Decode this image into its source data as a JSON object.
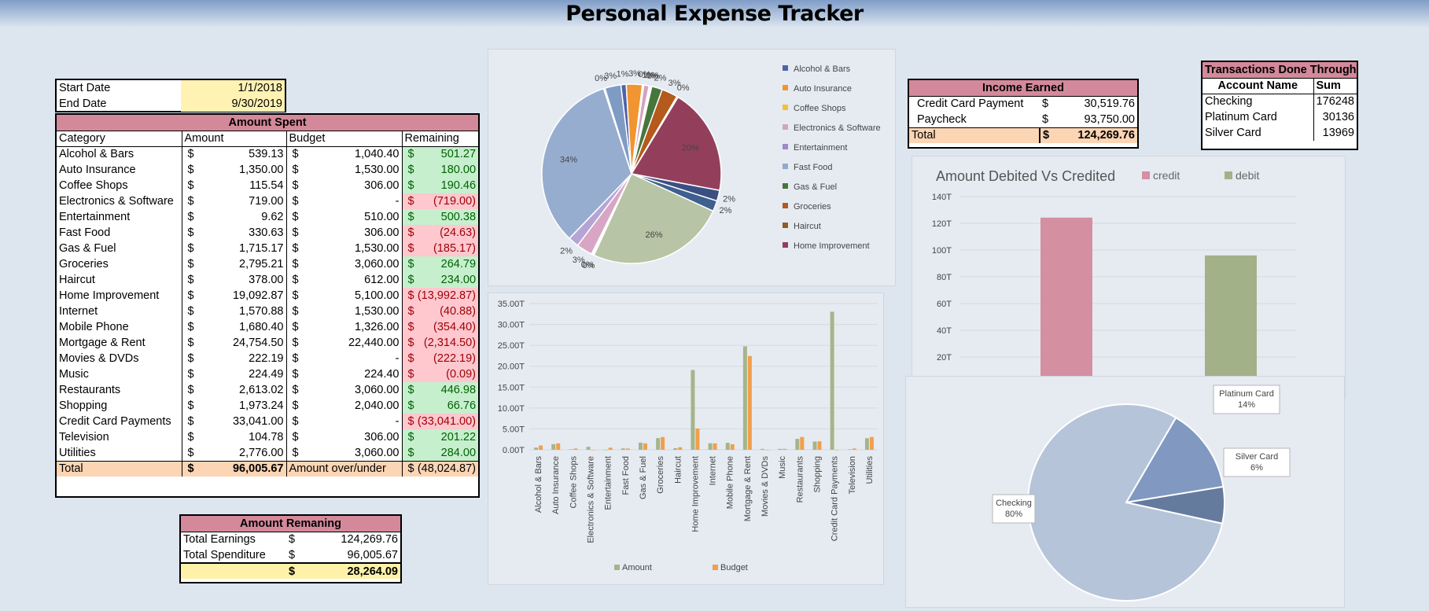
{
  "title": "Personal Expense Tracker",
  "dates": {
    "start_label": "Start Date",
    "start_value": "1/1/2018",
    "end_label": "End Date",
    "end_value": "9/30/2019"
  },
  "spent": {
    "title": "Amount Spent",
    "headers": [
      "Category",
      "Amount",
      "Budget",
      "Remaining"
    ],
    "rows": [
      [
        "Alcohol & Bars",
        "539.13",
        "1,040.40",
        "501.27",
        "pos"
      ],
      [
        "Auto Insurance",
        "1,350.00",
        "1,530.00",
        "180.00",
        "pos"
      ],
      [
        "Coffee Shops",
        "115.54",
        "306.00",
        "190.46",
        "pos"
      ],
      [
        "Electronics & Software",
        "719.00",
        "-",
        "(719.00)",
        "neg"
      ],
      [
        "Entertainment",
        "9.62",
        "510.00",
        "500.38",
        "pos"
      ],
      [
        "Fast Food",
        "330.63",
        "306.00",
        "(24.63)",
        "neg"
      ],
      [
        "Gas & Fuel",
        "1,715.17",
        "1,530.00",
        "(185.17)",
        "neg"
      ],
      [
        "Groceries",
        "2,795.21",
        "3,060.00",
        "264.79",
        "pos"
      ],
      [
        "Haircut",
        "378.00",
        "612.00",
        "234.00",
        "pos"
      ],
      [
        "Home Improvement",
        "19,092.87",
        "5,100.00",
        "(13,992.87)",
        "neg"
      ],
      [
        "Internet",
        "1,570.88",
        "1,530.00",
        "(40.88)",
        "neg"
      ],
      [
        "Mobile Phone",
        "1,680.40",
        "1,326.00",
        "(354.40)",
        "neg"
      ],
      [
        "Mortgage & Rent",
        "24,754.50",
        "22,440.00",
        "(2,314.50)",
        "neg"
      ],
      [
        "Movies & DVDs",
        "222.19",
        "-",
        "(222.19)",
        "neg"
      ],
      [
        "Music",
        "224.49",
        "224.40",
        "(0.09)",
        "neg"
      ],
      [
        "Restaurants",
        "2,613.02",
        "3,060.00",
        "446.98",
        "pos"
      ],
      [
        "Shopping",
        "1,973.24",
        "2,040.00",
        "66.76",
        "pos"
      ],
      [
        "Credit Card Payments",
        "33,041.00",
        "-",
        "(33,041.00)",
        "neg"
      ],
      [
        "Television",
        "104.78",
        "306.00",
        "201.22",
        "pos"
      ],
      [
        "Utilities",
        "2,776.00",
        "3,060.00",
        "284.00",
        "pos"
      ]
    ],
    "total_label": "Total",
    "total_amount": "96,005.67",
    "overunder_label": "Amount over/under",
    "overunder_value": "(48,024.87)",
    "currency": "$"
  },
  "remaining": {
    "title": "Amount Remaning",
    "earnings_label": "Total Earnings",
    "earnings_value": "124,269.76",
    "spend_label": "Total Spenditure",
    "spend_value": "96,005.67",
    "net_value": "28,264.09"
  },
  "income": {
    "title": "Income Earned",
    "rows": [
      [
        "Credit Card Payment",
        "30,519.76"
      ],
      [
        "Paycheck",
        "93,750.00"
      ]
    ],
    "total_label": "Total",
    "total_value": "124,269.76"
  },
  "transactions": {
    "title": "Transactions Done Through",
    "headers": [
      "Account Name",
      "Sum"
    ],
    "rows": [
      [
        "Checking",
        "176248"
      ],
      [
        "Platinum Card",
        "30136"
      ],
      [
        "Silver Card",
        "13969"
      ]
    ]
  },
  "chart_data": [
    {
      "type": "pie",
      "title": "",
      "legend_position": "right",
      "legend": [
        "Alcohol & Bars",
        "Auto Insurance",
        "Coffee Shops",
        "Electronics & Software",
        "Entertainment",
        "Fast Food",
        "Gas & Fuel",
        "Groceries",
        "Haircut",
        "Home Improvement"
      ],
      "slices": [
        {
          "label": "Alcohol & Bars",
          "value": 1,
          "text": "1%",
          "color": "#4e63a8"
        },
        {
          "label": "Auto Insurance",
          "value": 3,
          "text": "3%",
          "color": "#f0952f"
        },
        {
          "label": "Coffee Shops",
          "value": 0,
          "text": "0%",
          "color": "#f1c232"
        },
        {
          "label": "Electronics & Software",
          "value": 1,
          "text": "1%",
          "color": "#d4a3bf"
        },
        {
          "label": "Entertainment",
          "value": 0,
          "text": "0%",
          "color": "#9d8bc4"
        },
        {
          "label": "Fast Food",
          "value": 0,
          "text": "0%",
          "color": "#93a9cc"
        },
        {
          "label": "Gas & Fuel",
          "value": 2,
          "text": "2%",
          "color": "#47763c"
        },
        {
          "label": "Groceries",
          "value": 3,
          "text": "3%",
          "color": "#b35a1c"
        },
        {
          "label": "Haircut",
          "value": 0,
          "text": "0%",
          "color": "#8d5e24"
        },
        {
          "label": "Home Improvement",
          "value": 20,
          "text": "20%",
          "color": "#933f5c"
        },
        {
          "label": "Internet",
          "value": 2,
          "text": "2%",
          "color": "#3b4f82"
        },
        {
          "label": "Mobile Phone",
          "value": 2,
          "text": "2%",
          "color": "#3f5f8f"
        },
        {
          "label": "Mortgage & Rent",
          "value": 26,
          "text": "26%",
          "color": "#b7c4a5"
        },
        {
          "label": "Movies & DVDs",
          "value": 0,
          "text": "0%",
          "color": "#a8c0dc"
        },
        {
          "label": "Music",
          "value": 0,
          "text": "0%",
          "color": "#c7d5e5"
        },
        {
          "label": "Restaurants",
          "value": 3,
          "text": "3%",
          "color": "#d8a5c4"
        },
        {
          "label": "Shopping",
          "value": 2,
          "text": "2%",
          "color": "#b4a5d6"
        },
        {
          "label": "Credit Card Payments",
          "value": 34,
          "text": "34%",
          "color": "#96add0"
        },
        {
          "label": "Television",
          "value": 0,
          "text": "0%",
          "color": "#aec3de"
        },
        {
          "label": "Utilities",
          "value": 3,
          "text": "3%",
          "color": "#7f9bc4"
        }
      ]
    },
    {
      "type": "bar",
      "title": "",
      "categories": [
        "Alcohol & Bars",
        "Auto Insurance",
        "Coffee Shops",
        "Electronics & Software",
        "Entertainment",
        "Fast Food",
        "Gas & Fuel",
        "Groceries",
        "Haircut",
        "Home Improvement",
        "Internet",
        "Mobile Phone",
        "Mortgage & Rent",
        "Movies & DVDs",
        "Music",
        "Restaurants",
        "Shopping",
        "Credit Card Payments",
        "Television",
        "Utilities"
      ],
      "series": [
        {
          "name": "Amount",
          "color": "#a5b58a",
          "values": [
            539.13,
            1350,
            115.54,
            719,
            9.62,
            330.63,
            1715.17,
            2795.21,
            378,
            19092.87,
            1570.88,
            1680.4,
            24754.5,
            222.19,
            224.49,
            2613.02,
            1973.24,
            33041,
            104.78,
            2776
          ]
        },
        {
          "name": "Budget",
          "color": "#f0a04b",
          "values": [
            1040.4,
            1530,
            306,
            0,
            510,
            306,
            1530,
            3060,
            612,
            5100,
            1530,
            1326,
            22440,
            0,
            224.4,
            3060,
            2040,
            0,
            306,
            3060
          ]
        }
      ],
      "yticks": [
        "0.00T",
        "5.00T",
        "10.00T",
        "15.00T",
        "20.00T",
        "25.00T",
        "30.00T",
        "35.00T"
      ],
      "ylim": [
        0,
        35000
      ],
      "legend_position": "bottom"
    },
    {
      "type": "bar",
      "title": "Amount Debited Vs Credited",
      "categories": [
        "credit",
        "debit"
      ],
      "series": [
        {
          "name": "credit",
          "color": "#d48fa0",
          "values": [
            124269.76
          ]
        },
        {
          "name": "debit",
          "color": "#a3b189",
          "values": [
            96005.67
          ]
        }
      ],
      "yticks": [
        "0T",
        "20T",
        "40T",
        "60T",
        "80T",
        "100T",
        "120T",
        "140T"
      ],
      "ylim": [
        0,
        140000
      ],
      "legend_position": "top"
    },
    {
      "type": "pie",
      "title": "",
      "slices": [
        {
          "label": "Checking",
          "value": 80,
          "text": "80%",
          "color": "#b6c4da"
        },
        {
          "label": "Platinum Card",
          "value": 14,
          "text": "14%",
          "color": "#8199c0"
        },
        {
          "label": "Silver Card",
          "value": 6,
          "text": "6%",
          "color": "#657b9d"
        }
      ]
    }
  ]
}
